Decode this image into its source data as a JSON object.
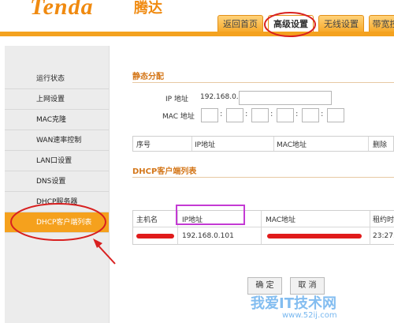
{
  "brand": {
    "logo_en": "Tenda",
    "logo_cn": "腾达"
  },
  "tabs": [
    {
      "label": "返回首页",
      "active": false
    },
    {
      "label": "高级设置",
      "active": true
    },
    {
      "label": "无线设置",
      "active": false
    },
    {
      "label": "带宽控",
      "active": false
    }
  ],
  "sidebar": {
    "items": [
      {
        "label": "运行状态"
      },
      {
        "label": "上网设置"
      },
      {
        "label": "MAC克隆"
      },
      {
        "label": "WAN速率控制"
      },
      {
        "label": "LAN口设置"
      },
      {
        "label": "DNS设置"
      },
      {
        "label": "DHCP服务器"
      },
      {
        "label": "DHCP客户端列表",
        "active": true
      }
    ]
  },
  "static_alloc": {
    "title": "静态分配",
    "ip_label": "IP 地址",
    "ip_prefix": "192.168.0.",
    "mac_label": "MAC 地址",
    "table_headers": [
      "序号",
      "IP地址",
      "MAC地址",
      "删除"
    ]
  },
  "dhcp_list": {
    "title": "DHCP客户端列表",
    "headers": [
      "主机名",
      "IP地址",
      "MAC地址",
      "租约时"
    ],
    "rows": [
      {
        "ip": "192.168.0.101",
        "lease": "23:27:"
      }
    ]
  },
  "buttons": {
    "confirm": "确 定",
    "cancel": "取 消"
  },
  "watermark": {
    "text": "我爱IT技术网",
    "url": "www.52ij.com"
  },
  "colors": {
    "accent": "#f5a11d",
    "highlight": "#c43ad4",
    "redaction": "#e01b1b"
  }
}
